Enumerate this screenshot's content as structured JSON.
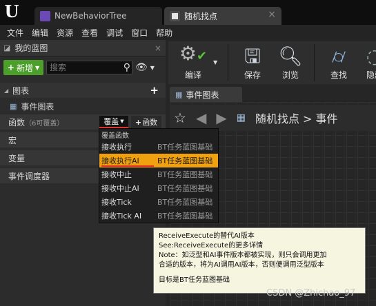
{
  "tabs": [
    {
      "label": "NewBehaviorTree"
    },
    {
      "label": "随机找点"
    }
  ],
  "menu": [
    "文件",
    "编辑",
    "资源",
    "查看",
    "调试",
    "窗口",
    "帮助"
  ],
  "my_blueprint": {
    "title": "我的蓝图",
    "add_label": "新增",
    "search_placeholder": "搜索"
  },
  "sections": {
    "graphs": "图表",
    "event_graph": "事件图表",
    "functions": "函数",
    "functions_note": "（6可覆盖）",
    "override": "覆盖",
    "add_function": "函数",
    "macros": "宏",
    "variables": "变量",
    "dispatchers": "事件调度器"
  },
  "override_menu": {
    "header": "覆盖函数",
    "items": [
      {
        "name": "接收执行",
        "category": "BT任务蓝图基础"
      },
      {
        "name": "接收执行AI",
        "category": "BT任务蓝图基础"
      },
      {
        "name": "接收中止",
        "category": "BT任务蓝图基础"
      },
      {
        "name": "接收中止AI",
        "category": "BT任务蓝图基础"
      },
      {
        "name": "接收Tick",
        "category": "BT任务蓝图基础"
      },
      {
        "name": "接收Tick AI",
        "category": "BT任务蓝图基础"
      }
    ],
    "selected_index": 1
  },
  "toolbar": {
    "compile": "编译",
    "save": "保存",
    "browse": "浏览",
    "find": "查找",
    "hide": "隐藏"
  },
  "graph_tab": "事件图表",
  "breadcrumb": {
    "path": "随机找点 > 事件"
  },
  "tooltip": {
    "line1": "ReceiveExecute的替代AI版本",
    "line2": "See:ReceiveExecute的更多详情",
    "line3": "Note：如泛型和AI事件版本都被实现，则只会调用更加",
    "line4": "合适的版本，将为AI调用AI版本，否则便调用泛型版本",
    "line5": "目标是BT任务蓝图基础"
  },
  "watermark": "CSDN @Zhichao_97",
  "colors": {
    "accent_selected": "#f0a10f",
    "add_button": "#4d9f2c"
  }
}
